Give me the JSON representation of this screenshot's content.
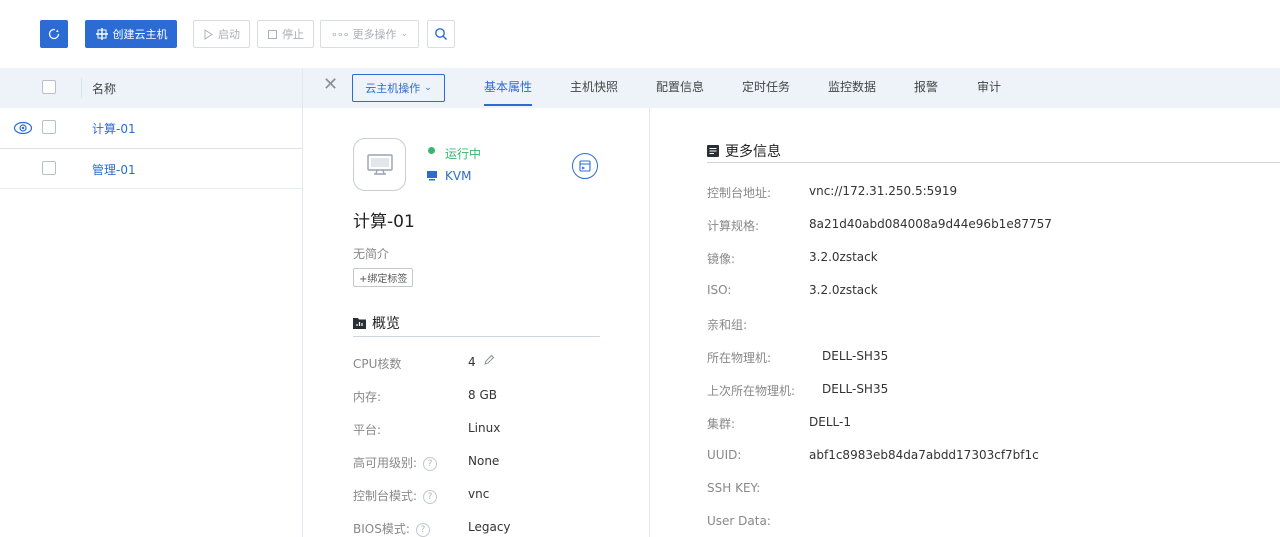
{
  "toolbar": {
    "create_label": "创建云主机",
    "start_label": "启动",
    "stop_label": "停止",
    "more_label": "更多操作"
  },
  "list": {
    "header_name": "名称",
    "rows": [
      {
        "name": "计算-01"
      },
      {
        "name": "管理-01"
      }
    ]
  },
  "detail": {
    "ops_label": "云主机操作",
    "tabs": [
      "基本属性",
      "主机快照",
      "配置信息",
      "定时任务",
      "监控数据",
      "报警",
      "审计"
    ],
    "status": "运行中",
    "hypervisor": "KVM",
    "vm_name": "计算-01",
    "description": "无简介",
    "bind_tag": "+绑定标签",
    "overview_title": "概览",
    "overview": [
      {
        "label": "CPU核数",
        "value": "4"
      },
      {
        "label": "内存:",
        "value": "8 GB"
      },
      {
        "label": "平台:",
        "value": "Linux"
      },
      {
        "label": "高可用级别:",
        "value": "None"
      },
      {
        "label": "控制台模式:",
        "value": "vnc"
      },
      {
        "label": "BIOS模式:",
        "value": "Legacy"
      }
    ],
    "more_title": "更多信息",
    "more": [
      {
        "label": "控制台地址:",
        "value": "vnc://172.31.250.5:5919"
      },
      {
        "label": "计算规格:",
        "value": "8a21d40abd084008a9d44e96b1e87757"
      },
      {
        "label": "镜像:",
        "value": "3.2.0zstack"
      },
      {
        "label": "ISO:",
        "value": "3.2.0zstack"
      },
      {
        "label": "亲和组:",
        "value": ""
      },
      {
        "label": "所在物理机:",
        "value": "DELL-SH35"
      },
      {
        "label": "上次所在物理机:",
        "value": "DELL-SH35"
      },
      {
        "label": "集群:",
        "value": "DELL-1"
      },
      {
        "label": "UUID:",
        "value": "abf1c8983eb84da7abdd17303cf7bf1c"
      },
      {
        "label": "SSH KEY:",
        "value": ""
      },
      {
        "label": "User Data:",
        "value": ""
      }
    ]
  },
  "colors": {
    "accent": "#2c6bd3",
    "running": "#3bb56c",
    "header_bg": "#eef3f9"
  }
}
